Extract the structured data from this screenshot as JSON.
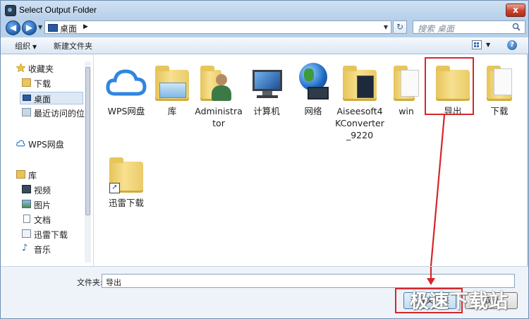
{
  "window": {
    "title": "Select Output Folder",
    "close_label": "x"
  },
  "address": {
    "path": "桌面",
    "search_placeholder": "搜索 桌面"
  },
  "toolbar": {
    "organize": "组织",
    "new_folder": "新建文件夹"
  },
  "sidebar": {
    "favorites_header": "收藏夹",
    "favorites": [
      {
        "label": "下载",
        "icon": "download-folder-icon"
      },
      {
        "label": "桌面",
        "icon": "desktop-icon",
        "selected": true
      },
      {
        "label": "最近访问的位",
        "icon": "recent-places-icon"
      }
    ],
    "wps": "WPS网盘",
    "library_header": "库",
    "libraries": [
      {
        "label": "视频",
        "icon": "video-library-icon"
      },
      {
        "label": "图片",
        "icon": "picture-library-icon"
      },
      {
        "label": "文档",
        "icon": "document-library-icon"
      },
      {
        "label": "迅雷下载",
        "icon": "xunlei-library-icon"
      },
      {
        "label": "音乐",
        "icon": "music-library-icon"
      }
    ]
  },
  "items": [
    {
      "name": "WPS网盘",
      "icon": "cloud-icon"
    },
    {
      "name": "库",
      "icon": "library-folder-icon"
    },
    {
      "name": "Administrator",
      "icon": "user-folder-icon"
    },
    {
      "name": "计算机",
      "icon": "computer-icon"
    },
    {
      "name": "网络",
      "icon": "network-globe-icon"
    },
    {
      "name": "Aiseesoft4KConverter_9220",
      "icon": "folder-icon"
    },
    {
      "name": "win",
      "icon": "folder-icon"
    },
    {
      "name": "导出",
      "icon": "folder-icon",
      "highlighted": true
    },
    {
      "name": "下载",
      "icon": "folder-icon"
    },
    {
      "name": "迅雷下载",
      "icon": "shortcut-folder-icon"
    }
  ],
  "footer": {
    "filename_label": "文件夹:",
    "filename_value": "导出",
    "select_button": "选择文件夹",
    "cancel_button": "取消"
  },
  "watermark": "极速下载站",
  "colors": {
    "highlight_red": "#d7262a",
    "folder_yellow": "#f0d27a",
    "accent_blue": "#1f5fae"
  }
}
